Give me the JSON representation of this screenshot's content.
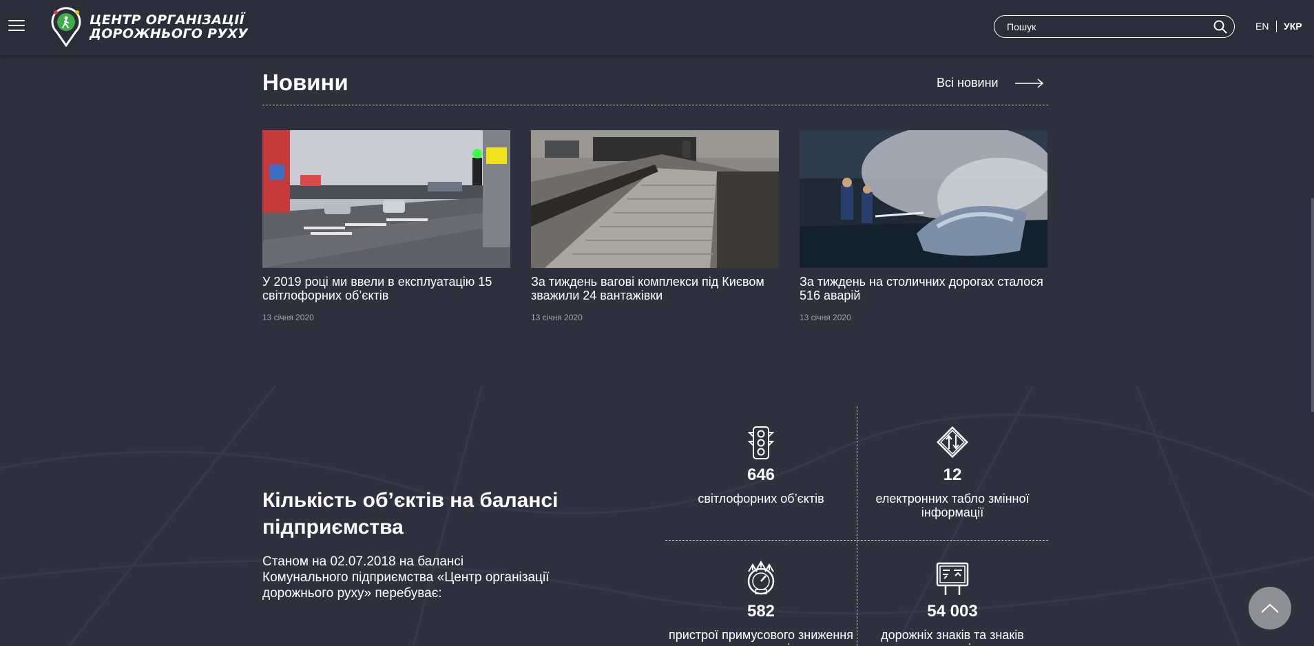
{
  "header": {
    "logo_line1": "Центр організації",
    "logo_line2": "дорожнього руху",
    "search_placeholder": "Пошук",
    "lang_en": "EN",
    "lang_ukr": "УКР"
  },
  "news": {
    "title": "Новини",
    "all_link": "Всі новини",
    "items": [
      {
        "headline": "У 2019 році ми ввели в експлуатацію 15 світлофорних об’єктів",
        "date": "13 січня 2020"
      },
      {
        "headline": "За тиждень вагові комплекси під Києвом зважили 24 вантажівки",
        "date": "13 січня 2020"
      },
      {
        "headline": "За тиждень на столичних дорогах сталося 516 аварій",
        "date": "13 січня 2020"
      }
    ]
  },
  "stats": {
    "title": "Кількість об’єктів на балансі підприємства",
    "text": "Станом на 02.07.2018 на балансі Комунального підприємства «Центр організації дорожнього руху» перебуває:",
    "items": [
      {
        "icon": "traffic-light-icon",
        "number": "646",
        "label": "світлофорних об’єктів"
      },
      {
        "icon": "variable-sign-icon",
        "number": "12",
        "label": "електронних табло змінної інформації"
      },
      {
        "icon": "speedometer-icon",
        "number": "582",
        "label": "пристрої примусового зниження швидкості"
      },
      {
        "icon": "road-sign-board-icon",
        "number": "54 003",
        "label": "дорожніх знаків та знаків маршрутного орієнтування"
      }
    ]
  }
}
